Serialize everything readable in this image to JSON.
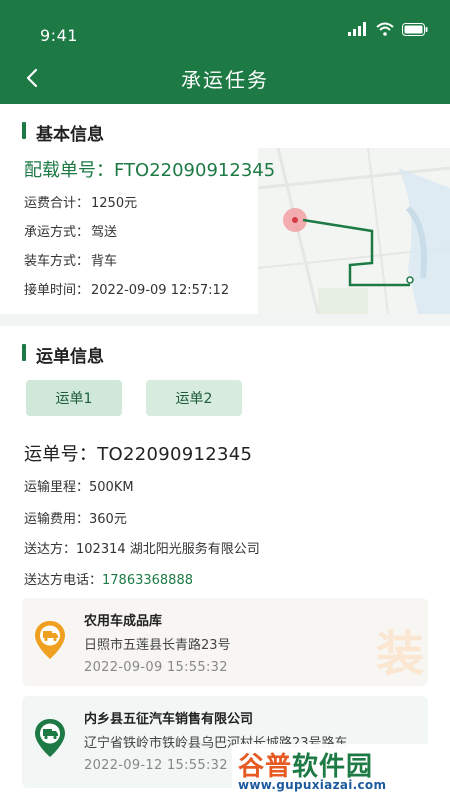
{
  "status": {
    "time": "9:41"
  },
  "nav": {
    "title": "承运任务"
  },
  "basic": {
    "section_title": "基本信息",
    "order_label": "配载单号：",
    "order_no": "FTO22090912345",
    "rows": [
      {
        "label": "运费合计：",
        "value": "1250元"
      },
      {
        "label": "承运方式：",
        "value": "驾送"
      },
      {
        "label": "装车方式：",
        "value": "背车"
      },
      {
        "label": "接单时间：",
        "value": "2022-09-09   12:57:12"
      }
    ]
  },
  "waybill": {
    "section_title": "运单信息",
    "tabs": [
      {
        "label": "运单1"
      },
      {
        "label": "运单2"
      }
    ],
    "no_label": "运单号：",
    "no_value": "TO22090912345",
    "rows": [
      {
        "label": "运输里程：",
        "value": "500KM"
      },
      {
        "label": "运输费用：",
        "value": "360元"
      },
      {
        "label": "送达方：",
        "value": "102314   湖北阳光服务有限公司"
      }
    ],
    "phone_label": "送达方电话：",
    "phone": "17863368888",
    "locations": [
      {
        "name": "农用车成品库",
        "address": "日照市五莲县长青路23号",
        "time": "2022-09-09   15:55:32",
        "stamp": "装"
      },
      {
        "name": "内乡县五征汽车销售有限公司",
        "address": "辽宁省铁岭市铁岭县乌巴河村长城路23号路东",
        "time": "2022-09-12   15:55:32"
      }
    ]
  },
  "watermark": {
    "brand_part1": "谷普",
    "brand_part2": "软件园",
    "url": "www.gupuxiazai.com"
  },
  "colors": {
    "primary": "#1d7a45",
    "accent_orange": "#f0a020",
    "link": "#1d7a45"
  }
}
